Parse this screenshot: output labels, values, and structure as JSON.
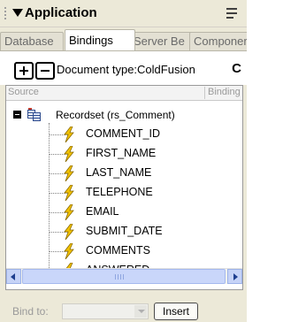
{
  "panel": {
    "title": "Application",
    "menu_icon": "options-menu-icon"
  },
  "tabs": [
    {
      "label": "Database",
      "active": false
    },
    {
      "label": "Bindings",
      "active": true
    },
    {
      "label": "Server Be",
      "active": false
    },
    {
      "label": "Componer",
      "active": false
    }
  ],
  "toolbar": {
    "add_icon": "plus-icon",
    "remove_icon": "minus-icon",
    "doc_type": "Document type:ColdFusion",
    "refresh_glyph": "C"
  },
  "columns": {
    "source": "Source",
    "binding": "Binding"
  },
  "recordset": {
    "label": "Recordset (rs_Comment)",
    "icon": "recordset-icon",
    "fields": [
      "COMMENT_ID",
      "FIRST_NAME",
      "LAST_NAME",
      "TELEPHONE",
      "EMAIL",
      "SUBMIT_DATE",
      "COMMENTS",
      "ANSWERED"
    ]
  },
  "bottom": {
    "bind_to_label": "Bind to:",
    "bind_to_value": "",
    "insert_label": "Insert"
  },
  "colors": {
    "panel_bg": "#ece9d8",
    "scrollbar": "#c6d3f7",
    "bolt": "#f2c200"
  }
}
